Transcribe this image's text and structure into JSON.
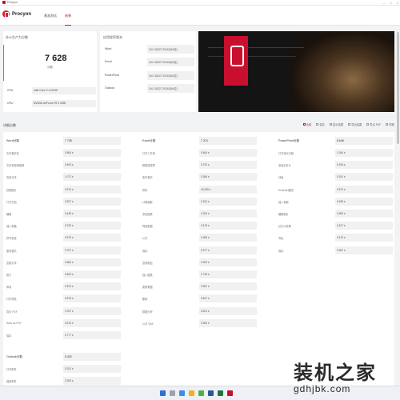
{
  "window": {
    "title": "Procyon"
  },
  "appbar": {
    "brand": "Procyon",
    "tabs": [
      {
        "label": "基准测试"
      },
      {
        "label": "结果"
      }
    ]
  },
  "score_card": {
    "title": "办公生产力分数",
    "score": "7 628",
    "subtitle": "分数",
    "hardware": [
      {
        "label": "CPU",
        "value": "Intel Core i7-14700K"
      },
      {
        "label": "GPU",
        "value": "NVIDIA GeForce RTX 4090"
      }
    ]
  },
  "version_card": {
    "title": "应用程序版本",
    "rows": [
      {
        "app": "Word",
        "version": "16.0.18227.20162(64位)"
      },
      {
        "app": "Excel",
        "version": "16.0.18227.20162(64位)"
      },
      {
        "app": "PowerPoint",
        "version": "16.0.18227.20162(64位)"
      },
      {
        "app": "Outlook",
        "version": "16.0.18227.20162(64位)"
      }
    ]
  },
  "results": {
    "title": "详细分数",
    "toolbar": [
      "比较",
      "保存",
      "显示结果",
      "导出结果",
      "导出 PDF",
      "帮助"
    ],
    "columns": [
      {
        "name": "Word分数",
        "score": "7 795",
        "rows": [
          {
            "label": "文本格式化",
            "value": "0.806 s"
          },
          {
            "label": "文本查找和替换",
            "value": "0.843 s"
          },
          {
            "label": "查找文本",
            "value": "1.072 s"
          },
          {
            "label": "处理图片",
            "value": "0.576 s"
          },
          {
            "label": "打开文档",
            "value": "0.527 s"
          },
          {
            "label": "编辑",
            "value": "0.438 s"
          },
          {
            "label": "插入表格",
            "value": "0.975 s"
          },
          {
            "label": "拼写检查",
            "value": "0.575 s"
          },
          {
            "label": "更改格式",
            "value": "0.707 s"
          },
          {
            "label": "复制文本",
            "value": "0.684 s"
          },
          {
            "label": "修订",
            "value": "0.843 s"
          },
          {
            "label": "审阅",
            "value": "0.875 s"
          },
          {
            "label": "打印预览",
            "value": "0.576 s"
          },
          {
            "label": "导出 PDF",
            "value": "0.787 s"
          },
          {
            "label": "Save as PDF",
            "value": "0.676 s"
          },
          {
            "label": "保存",
            "value": "0.777 s"
          }
        ]
      },
      {
        "name": "Excel分数",
        "score": "7 374",
        "rows": [
          {
            "label": "打开工作簿",
            "value": "0.469 s"
          },
          {
            "label": "数据透视表",
            "value": "0.375 s"
          },
          {
            "label": "条件格式",
            "value": "0.386 s"
          },
          {
            "label": "排序",
            "value": "18.338 s"
          },
          {
            "label": "计算函数",
            "value": "0.342 s"
          },
          {
            "label": "添加图表",
            "value": "0.325 s"
          },
          {
            "label": "筛选数据",
            "value": "0.476 s"
          },
          {
            "label": "公式",
            "value": "0.368 s"
          },
          {
            "label": "保存",
            "value": "0.377 s"
          },
          {
            "label": "复制粘贴",
            "value": "0.209 s"
          },
          {
            "label": "插入图表",
            "value": "1.736 s"
          },
          {
            "label": "更新数据",
            "value": "0.387 s"
          },
          {
            "label": "删除",
            "value": "0.467 s"
          },
          {
            "label": "数据分析",
            "value": "0.624 s"
          },
          {
            "label": "公式 VBA",
            "value": "0.963 s"
          }
        ]
      },
      {
        "name": "PowerPoint分数",
        "score": "8 648",
        "rows": [
          {
            "label": "打开演示文稿",
            "value": "1.064 s"
          },
          {
            "label": "添加幻灯片",
            "value": "0.196 s"
          },
          {
            "label": "动画",
            "value": "0.152 s"
          },
          {
            "label": "SmartArt图形",
            "value": "0.679 s"
          },
          {
            "label": "插入视频",
            "value": "0.638 s"
          },
          {
            "label": "编辑图片",
            "value": "0.383 s"
          },
          {
            "label": "幻灯片放映",
            "value": "0.437 s"
          },
          {
            "label": "导出",
            "value": "0.476 s"
          },
          {
            "label": "保存",
            "value": "0.387 s"
          }
        ]
      }
    ],
    "outlook": {
      "name": "Outlook分数",
      "score": "5 302",
      "rows": [
        {
          "label": "打开邮件",
          "value": "0.322 s"
        },
        {
          "label": "搜索邮件",
          "value": "2.309 s"
        }
      ]
    }
  },
  "watermark": {
    "cn": "装机之家",
    "url": "gdhjbk.com"
  },
  "colors": {
    "accent": "#c8102e",
    "score_bar": "#3bb54a"
  }
}
